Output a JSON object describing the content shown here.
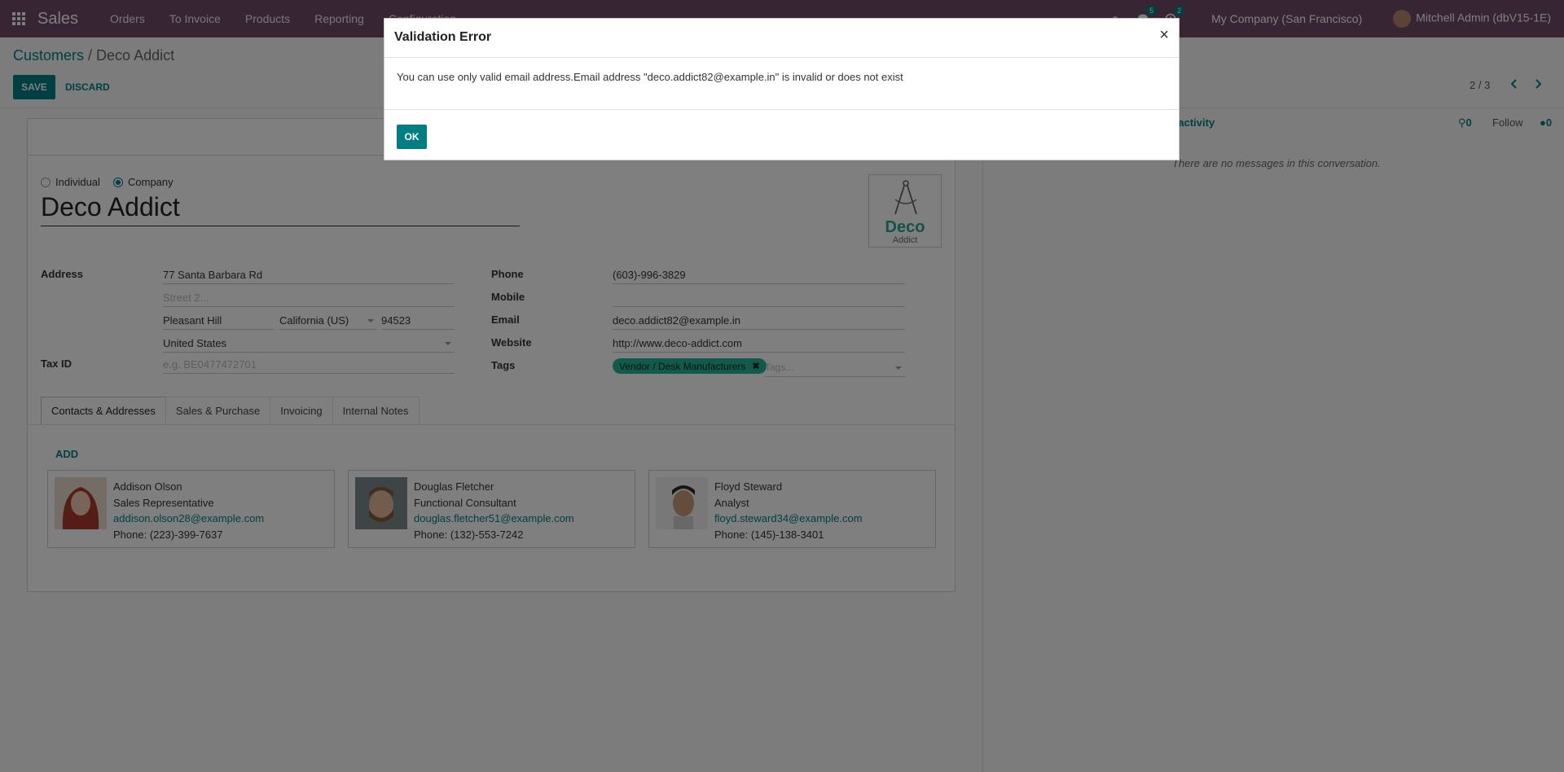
{
  "navbar": {
    "brand": "Sales",
    "menu": [
      "Orders",
      "To Invoice",
      "Products",
      "Reporting",
      "Configuration"
    ],
    "messages_badge": "5",
    "activities_badge": "2",
    "company": "My Company (San Francisco)",
    "user": "Mitchell Admin (dbV15-1E)"
  },
  "control_panel": {
    "breadcrumb_parent": "Customers",
    "breadcrumb_separator": " / ",
    "breadcrumb_current": "Deco Addict",
    "save_label": "SAVE",
    "discard_label": "DISCARD",
    "pager": "2 / 3"
  },
  "form": {
    "type_individual": "Individual",
    "type_company": "Company",
    "selected_type": "Company",
    "name": "Deco Addict",
    "logo_word": "Deco",
    "logo_sub": "Addict",
    "address_label": "Address",
    "street": "77 Santa Barbara Rd",
    "street2_placeholder": "Street 2...",
    "city": "Pleasant Hill",
    "state": "California (US)",
    "zip": "94523",
    "country": "United States",
    "tax_id_label": "Tax ID",
    "tax_id_placeholder": "e.g. BE0477472701",
    "phone_label": "Phone",
    "phone": "(603)-996-3829",
    "mobile_label": "Mobile",
    "mobile": "",
    "email_label": "Email",
    "email": "deco.addict82@example.in",
    "website_label": "Website",
    "website": "http://www.deco-addict.com",
    "tags_label": "Tags",
    "tag": "Vendor / Desk Manufacturers",
    "tags_placeholder": "Tags..."
  },
  "tabs": [
    "Contacts & Addresses",
    "Sales & Purchase",
    "Invoicing",
    "Internal Notes"
  ],
  "contacts": {
    "add_label": "ADD",
    "cards": [
      {
        "name": "Addison Olson",
        "role": "Sales Representative",
        "email": "addison.olson28@example.com",
        "phone": "Phone: (223)-399-7637"
      },
      {
        "name": "Douglas Fletcher",
        "role": "Functional Consultant",
        "email": "douglas.fletcher51@example.com",
        "phone": "Phone: (132)-553-7242"
      },
      {
        "name": "Floyd Steward",
        "role": "Analyst",
        "email": "floyd.steward34@example.com",
        "phone": "Phone: (145)-138-3401"
      }
    ]
  },
  "chatter": {
    "activity_label": "ule activity",
    "attachments_count": "0",
    "follow_label": "Follow",
    "followers_count": "0",
    "empty_message": "There are no messages in this conversation."
  },
  "dialog": {
    "title": "Validation Error",
    "close": "×",
    "message": "You can use only valid email address.Email address \"deco.addict82@example.in\" is invalid or does not exist",
    "ok_label": "OK"
  },
  "colors": {
    "navbar": "#714b67",
    "primary": "#017e84",
    "tag": "#21b799"
  }
}
